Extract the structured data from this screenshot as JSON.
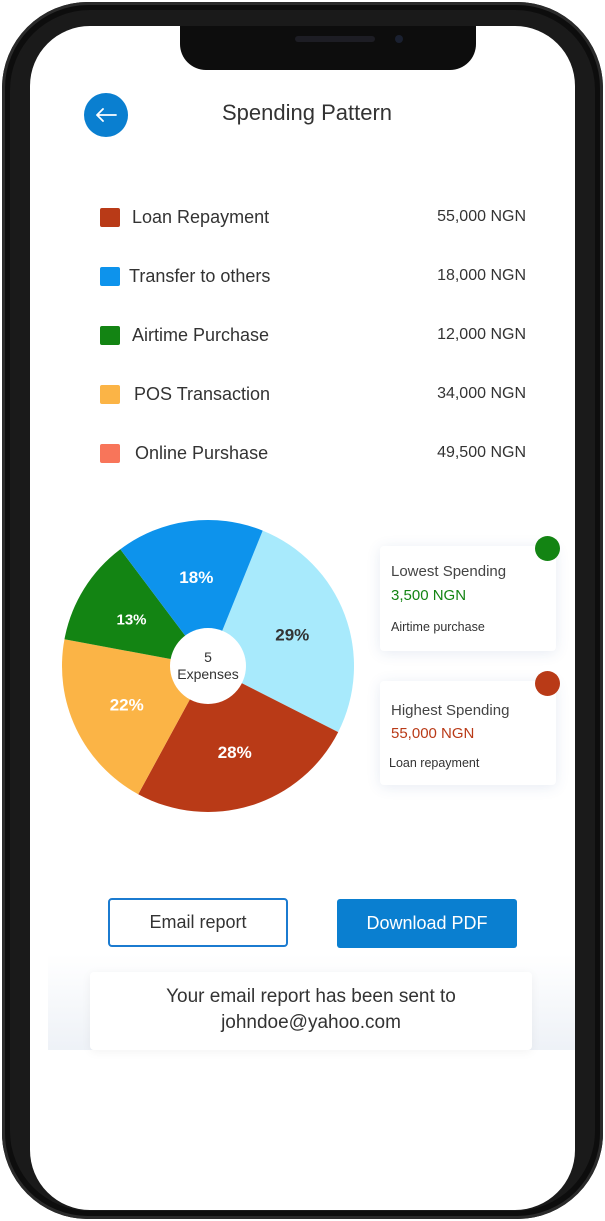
{
  "header": {
    "title": "Spending Pattern",
    "back_icon": "arrow-left-icon"
  },
  "legend": [
    {
      "label": "Loan Repayment",
      "amount": "55,000 NGN",
      "color": "#b93a17"
    },
    {
      "label": "Transfer to others",
      "amount": "18,000 NGN",
      "color": "#0d93ec"
    },
    {
      "label": "Airtime Purchase",
      "amount": "12,000 NGN",
      "color": "#138413"
    },
    {
      "label": "POS Transaction",
      "amount": "34,000 NGN",
      "color": "#fbb446"
    },
    {
      "label": "Online Purshase",
      "amount": "49,500 NGN",
      "color": "#f8755a"
    }
  ],
  "chart_data": {
    "type": "pie",
    "center_count": "5",
    "center_label": "Expenses",
    "slices": [
      {
        "label": "29%",
        "value": 29,
        "color": "#a8eafc",
        "text_color": "#333333"
      },
      {
        "label": "28%",
        "value": 28,
        "color": "#b93a17",
        "text_color": "#ffffff"
      },
      {
        "label": "22%",
        "value": 22,
        "color": "#fbb446",
        "text_color": "#ffffff"
      },
      {
        "label": "13%",
        "value": 13,
        "color": "#138413",
        "text_color": "#ffffff"
      },
      {
        "label": "18%",
        "value": 18,
        "color": "#0d93ec",
        "text_color": "#ffffff"
      }
    ]
  },
  "cards": {
    "lowest": {
      "title": "Lowest Spending",
      "amount": "3,500 NGN",
      "sub": "Airtime purchase",
      "color": "#138413"
    },
    "highest": {
      "title": "Highest Spending",
      "amount": "55,000 NGN",
      "sub": "Loan repayment",
      "color": "#b93a17"
    }
  },
  "actions": {
    "email_label": "Email report",
    "download_label": "Download PDF"
  },
  "toast": {
    "line1": "Your email report has been sent to",
    "line2": "johndoe@yahoo.com"
  }
}
